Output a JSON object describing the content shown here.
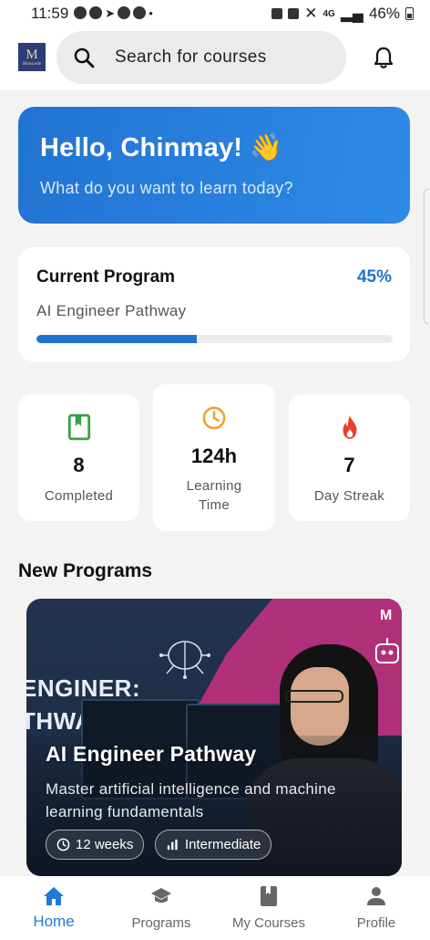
{
  "status_bar": {
    "time": "11:59",
    "battery": "46%",
    "network": "4G"
  },
  "header": {
    "logo_letter": "M",
    "logo_text": "Mansarde",
    "search_placeholder": "Search for courses"
  },
  "greeting": {
    "title": "Hello, Chinmay! 👋",
    "subtitle": "What do you want to learn today?"
  },
  "current_program": {
    "label": "Current Program",
    "percent_text": "45%",
    "progress": 0.45,
    "name": "AI Engineer Pathway"
  },
  "stats": [
    {
      "icon": "book-icon",
      "value": "8",
      "label": "Completed",
      "color": "#37a14a"
    },
    {
      "icon": "clock-icon",
      "value": "124h",
      "label": "Learning Time",
      "color": "#f29c1f"
    },
    {
      "icon": "flame-icon",
      "value": "7",
      "label": "Day Streak",
      "color": "#e8412b"
    }
  ],
  "new_programs": {
    "title": "New Programs",
    "course": {
      "image_text_line1": "ENGINER:",
      "image_text_line2": "THWAY",
      "title": "AI Engineer Pathway",
      "description": "Master artificial intelligence and machine learning fundamentals",
      "duration": "12 weeks",
      "level": "Intermediate"
    }
  },
  "bottom_nav": [
    {
      "label": "Home",
      "icon": "home-icon",
      "active": true
    },
    {
      "label": "Programs",
      "icon": "graduation-cap-icon",
      "active": false
    },
    {
      "label": "My Courses",
      "icon": "bookmark-book-icon",
      "active": false
    },
    {
      "label": "Profile",
      "icon": "person-icon",
      "active": false
    }
  ],
  "colors": {
    "accent": "#1f74cf",
    "background": "#f3f3f3"
  }
}
